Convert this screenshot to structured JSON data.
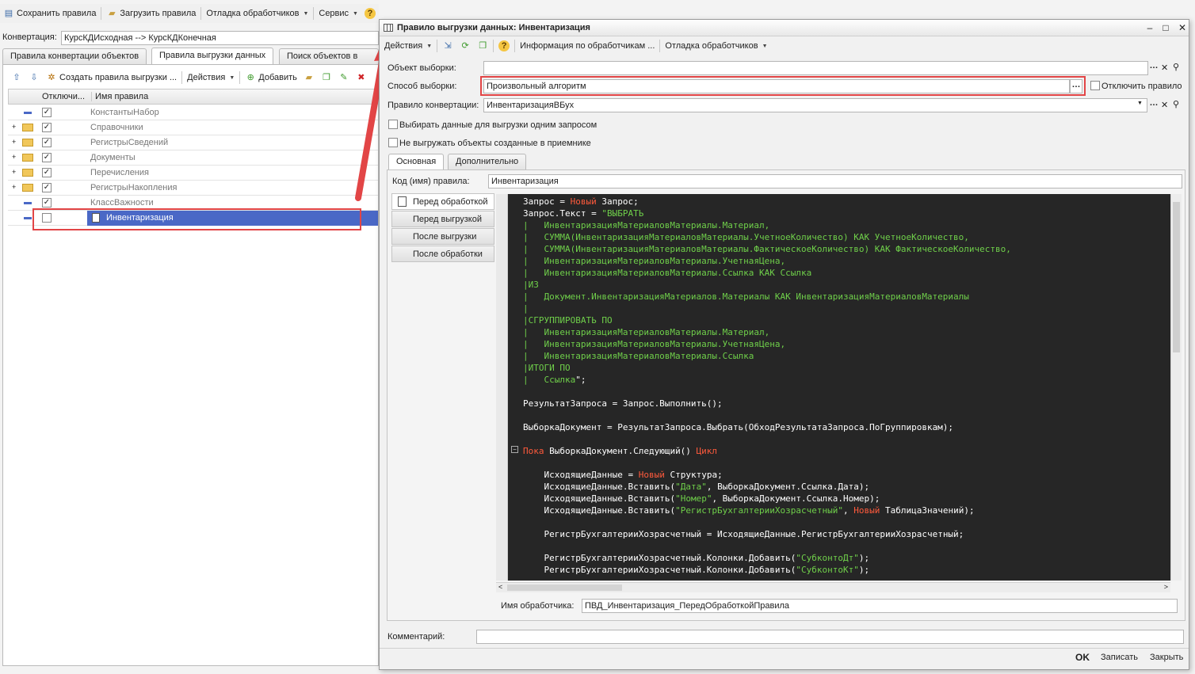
{
  "main_toolbar": {
    "save": "Сохранить правила",
    "load": "Загрузить правила",
    "debug": "Отладка обработчиков",
    "service": "Сервис"
  },
  "conversion": {
    "label": "Конвертация:",
    "value": "КурсКДИсходная --> КурсКДКонечная"
  },
  "main_tabs": [
    "Правила конвертации объектов",
    "Правила выгрузки данных",
    "Поиск объектов в при"
  ],
  "rules_toolbar": {
    "create": "Создать правила выгрузки ...",
    "actions": "Действия",
    "add": "Добавить"
  },
  "grid": {
    "columns": [
      "Отключи...",
      "Имя правила"
    ],
    "rows": [
      {
        "name": "КонстантыНабор",
        "checked": true,
        "type": "item"
      },
      {
        "name": "Справочники",
        "checked": true,
        "type": "folder"
      },
      {
        "name": "РегистрыСведений",
        "checked": true,
        "type": "folder"
      },
      {
        "name": "Документы",
        "checked": true,
        "type": "folder"
      },
      {
        "name": "Перечисления",
        "checked": true,
        "type": "folder"
      },
      {
        "name": "РегистрыНакопления",
        "checked": true,
        "type": "folder"
      },
      {
        "name": "КлассВажности",
        "checked": true,
        "type": "item"
      },
      {
        "name": "Инвентаризация",
        "checked": false,
        "type": "selected"
      }
    ]
  },
  "dialog": {
    "title": "Правило выгрузки данных: Инвентаризация",
    "toolbar": {
      "actions": "Действия",
      "info": "Информация по обработчикам ...",
      "debug": "Отладка обработчиков"
    },
    "object_label": "Объект выборки:",
    "object_value": "",
    "method_label": "Способ выборки:",
    "method_value": "Произвольный алгоритм",
    "disable_rule": "Отключить правило",
    "conv_rule_label": "Правило конвертации:",
    "conv_rule_value": "ИнвентаризацияВБух",
    "single_query": "Выбирать данные для выгрузки одним запросом",
    "no_export_created": "Не выгружать объекты созданные в приемнике",
    "tabs": [
      "Основная",
      "Дополнительно"
    ],
    "code_label": "Код (имя) правила:",
    "code_value": "Инвентаризация",
    "handlers": [
      "Перед обработкой",
      "Перед выгрузкой",
      "После выгрузки",
      "После обработки"
    ],
    "handler_name_label": "Имя обработчика:",
    "handler_name_value": "ПВД_Инвентаризация_ПередОбработкойПравила",
    "comment_label": "Комментарий:",
    "ok": "OK",
    "write": "Записать",
    "close": "Закрыть"
  },
  "code_lines": [
    {
      "indent": "",
      "parts": [
        [
          "t",
          "Запрос = "
        ],
        [
          "k",
          "Новый"
        ],
        [
          "t",
          " Запрос;"
        ]
      ]
    },
    {
      "indent": "",
      "parts": [
        [
          "t",
          "Запрос.Текст = "
        ],
        [
          "s",
          "\"ВЫБРАТЬ"
        ]
      ]
    },
    {
      "indent": "",
      "parts": [
        [
          "s",
          "|   ИнвентаризацияМатериаловМатериалы.Материал,"
        ]
      ]
    },
    {
      "indent": "",
      "parts": [
        [
          "s",
          "|   СУММА(ИнвентаризацияМатериаловМатериалы.УчетноеКоличество) КАК УчетноеКоличество,"
        ]
      ]
    },
    {
      "indent": "",
      "parts": [
        [
          "s",
          "|   СУММА(ИнвентаризацияМатериаловМатериалы.ФактическоеКоличество) КАК ФактическоеКоличество,"
        ]
      ]
    },
    {
      "indent": "",
      "parts": [
        [
          "s",
          "|   ИнвентаризацияМатериаловМатериалы.УчетнаяЦена,"
        ]
      ]
    },
    {
      "indent": "",
      "parts": [
        [
          "s",
          "|   ИнвентаризацияМатериаловМатериалы.Ссылка КАК Ссылка"
        ]
      ]
    },
    {
      "indent": "",
      "parts": [
        [
          "s",
          "|ИЗ"
        ]
      ]
    },
    {
      "indent": "",
      "parts": [
        [
          "s",
          "|   Документ.ИнвентаризацияМатериалов.Материалы КАК ИнвентаризацияМатериаловМатериалы"
        ]
      ]
    },
    {
      "indent": "",
      "parts": [
        [
          "s",
          "|"
        ]
      ]
    },
    {
      "indent": "",
      "parts": [
        [
          "s",
          "|СГРУППИРОВАТЬ ПО"
        ]
      ]
    },
    {
      "indent": "",
      "parts": [
        [
          "s",
          "|   ИнвентаризацияМатериаловМатериалы.Материал,"
        ]
      ]
    },
    {
      "indent": "",
      "parts": [
        [
          "s",
          "|   ИнвентаризацияМатериаловМатериалы.УчетнаяЦена,"
        ]
      ]
    },
    {
      "indent": "",
      "parts": [
        [
          "s",
          "|   ИнвентаризацияМатериаловМатериалы.Ссылка"
        ]
      ]
    },
    {
      "indent": "",
      "parts": [
        [
          "s",
          "|ИТОГИ ПО"
        ]
      ]
    },
    {
      "indent": "",
      "parts": [
        [
          "s",
          "|   Ссылка"
        ],
        [
          "t",
          "\";"
        ]
      ]
    },
    {
      "indent": "",
      "parts": [
        [
          "t",
          ""
        ]
      ]
    },
    {
      "indent": "",
      "parts": [
        [
          "t",
          "РезультатЗапроса = Запрос.Выполнить();"
        ]
      ]
    },
    {
      "indent": "",
      "parts": [
        [
          "t",
          ""
        ]
      ]
    },
    {
      "indent": "",
      "parts": [
        [
          "t",
          "ВыборкаДокумент = РезультатЗапроса.Выбрать(ОбходРезультатаЗапроса.ПоГруппировкам);"
        ]
      ]
    },
    {
      "indent": "",
      "parts": [
        [
          "t",
          ""
        ]
      ]
    },
    {
      "indent": "",
      "parts": [
        [
          "k",
          "Пока"
        ],
        [
          "t",
          " ВыборкаДокумент.Следующий() "
        ],
        [
          "k",
          "Цикл"
        ]
      ]
    },
    {
      "indent": "",
      "parts": [
        [
          "t",
          ""
        ]
      ]
    },
    {
      "indent": "    ",
      "parts": [
        [
          "t",
          "ИсходящиеДанные = "
        ],
        [
          "k",
          "Новый"
        ],
        [
          "t",
          " Структура;"
        ]
      ]
    },
    {
      "indent": "    ",
      "parts": [
        [
          "t",
          "ИсходящиеДанные.Вставить("
        ],
        [
          "s",
          "\"Дата\""
        ],
        [
          "t",
          ", ВыборкаДокумент.Ссылка.Дата);"
        ]
      ]
    },
    {
      "indent": "    ",
      "parts": [
        [
          "t",
          "ИсходящиеДанные.Вставить("
        ],
        [
          "s",
          "\"Номер\""
        ],
        [
          "t",
          ", ВыборкаДокумент.Ссылка.Номер);"
        ]
      ]
    },
    {
      "indent": "    ",
      "parts": [
        [
          "t",
          "ИсходящиеДанные.Вставить("
        ],
        [
          "s",
          "\"РегистрБухгалтерииХозрасчетный\""
        ],
        [
          "t",
          ", "
        ],
        [
          "k",
          "Новый"
        ],
        [
          "t",
          " ТаблицаЗначений);"
        ]
      ]
    },
    {
      "indent": "",
      "parts": [
        [
          "t",
          ""
        ]
      ]
    },
    {
      "indent": "    ",
      "parts": [
        [
          "t",
          "РегистрБухгалтерииХозрасчетный = ИсходящиеДанные.РегистрБухгалтерииХозрасчетный;"
        ]
      ]
    },
    {
      "indent": "",
      "parts": [
        [
          "t",
          ""
        ]
      ]
    },
    {
      "indent": "    ",
      "parts": [
        [
          "t",
          "РегистрБухгалтерииХозрасчетный.Колонки.Добавить("
        ],
        [
          "s",
          "\"СубконтоДт\""
        ],
        [
          "t",
          ");"
        ]
      ]
    },
    {
      "indent": "    ",
      "parts": [
        [
          "t",
          "РегистрБухгалтерииХозрасчетный.Колонки.Добавить("
        ],
        [
          "s",
          "\"СубконтоКт\""
        ],
        [
          "t",
          ");"
        ]
      ]
    }
  ],
  "colors": {
    "accent": "#4a68c6",
    "highlight": "#e24546",
    "code_bg": "#262626",
    "keyword": "#ff5a3c",
    "string": "#6fcf4a"
  }
}
